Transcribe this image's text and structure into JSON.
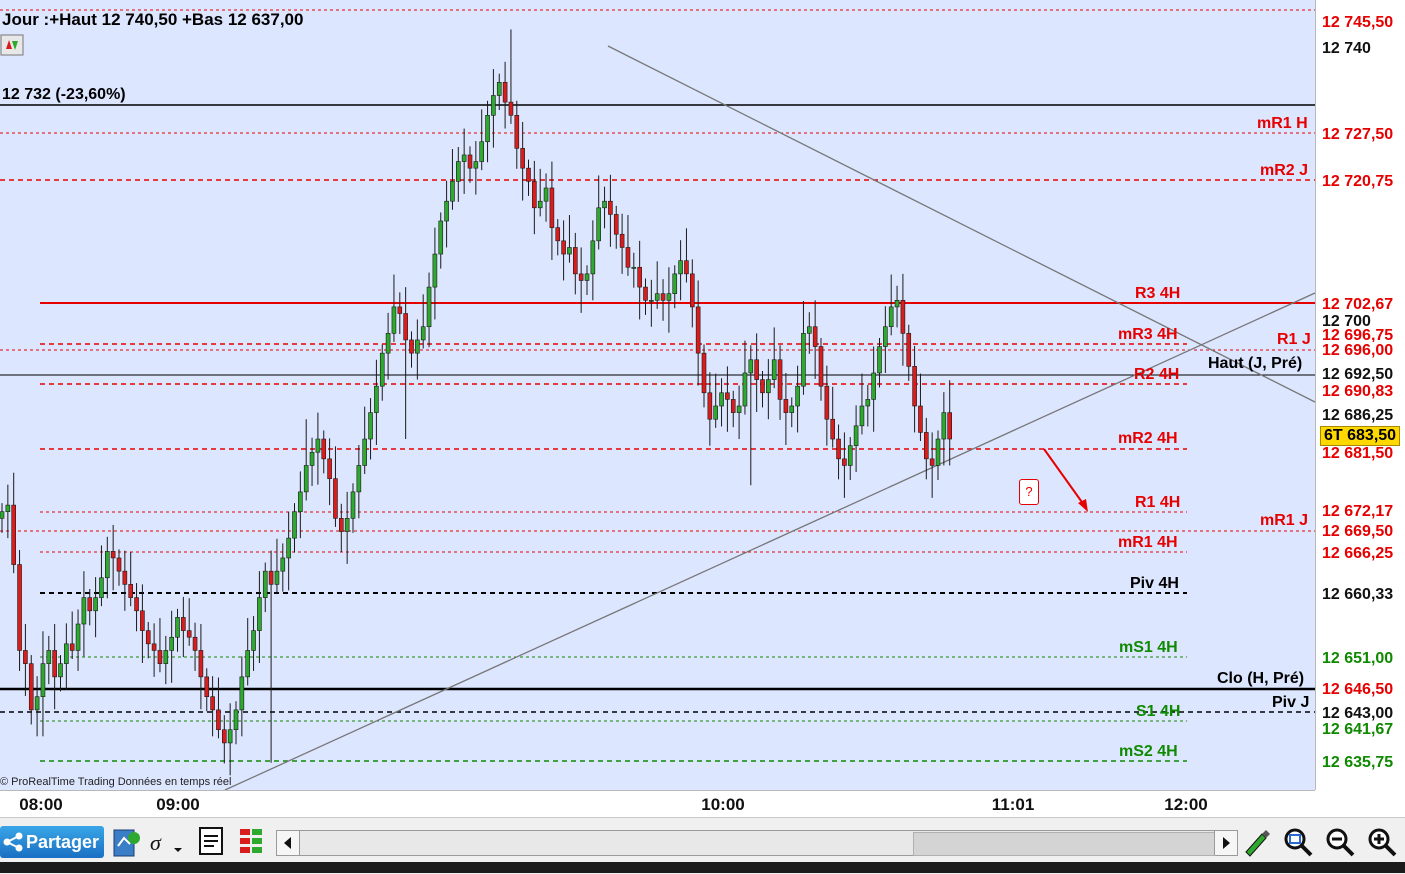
{
  "header": {
    "summary": "Jour :+Haut 12 740,50 +Bas 12 637,00",
    "fib_label": "12 732 (-23,60%)",
    "source_label": "© ProRealTime Trading  Données en temps réel",
    "question_marker": "?"
  },
  "price_axis": {
    "ticks": [
      "12 740",
      "12 700",
      "12 692,50",
      "12 686,25",
      "12 643,00"
    ],
    "red_tags": [
      "12 745,50",
      "12 727,50",
      "12 720,75",
      "12 702,67",
      "12 696,75",
      "12 696,00",
      "12 690,83",
      "12 681,50",
      "12 672,17",
      "12 669,50",
      "12 666,25",
      "12 646,50"
    ],
    "green_tags": [
      "12 651,00",
      "12 641,67",
      "12 635,75"
    ],
    "black_tags": [
      "12 660,33"
    ],
    "current_tag": "6T 683,50"
  },
  "time_axis": {
    "ticks": [
      "08:00",
      "09:00",
      "10:00",
      "11:01",
      "12:00"
    ]
  },
  "levels": {
    "mR1_H": "mR1 H",
    "mR2_J": "mR2 J",
    "R3_4H": "R3 4H",
    "mR3_4H": "mR3 4H",
    "R1_J": "R1 J",
    "haut_j_pre": "Haut (J, Pré)",
    "R2_4H": "R2 4H",
    "mR2_4H": "mR2 4H",
    "R1_4H": "R1 4H",
    "mR1_J": "mR1 J",
    "mR1_4H": "mR1 4H",
    "Piv_4H": "Piv 4H",
    "mS1_4H": "mS1 4H",
    "clo_h_pre": "Clo (H, Pré)",
    "Piv_J": "Piv J",
    "S1_4H": "S1 4H",
    "mS2_4H": "mS2 4H"
  },
  "toolbar": {
    "share_label": "Partager"
  },
  "colors": {
    "bull": "#2ea82e",
    "bear": "#d91c1c",
    "resistance": "#e60000",
    "support": "#0f8a00",
    "background": "#dde6ff"
  },
  "chart_data": {
    "type": "candlestick",
    "title": "Jour :+Haut 12 740,50 +Bas 12 637,00",
    "x_ticks": [
      "08:00",
      "09:00",
      "10:00",
      "11:01",
      "12:00"
    ],
    "ylim": [
      12632,
      12748
    ],
    "closes": [
      12673,
      12674,
      12665,
      12652,
      12650,
      12643,
      12645,
      12650,
      12652,
      12648,
      12650,
      12653,
      12652,
      12656,
      12660,
      12658,
      12660,
      12663,
      12667,
      12666,
      12664,
      12662,
      12660,
      12658,
      12655,
      12653,
      12652,
      12650,
      12652,
      12654,
      12657,
      12655,
      12654,
      12652,
      12648,
      12645,
      12643,
      12640,
      12638,
      12640,
      12643,
      12648,
      12652,
      12655,
      12660,
      12664,
      12662,
      12664,
      12666,
      12669,
      12673,
      12676,
      12680,
      12682,
      12684,
      12681,
      12678,
      12672,
      12670,
      12672,
      12676,
      12680,
      12684,
      12688,
      12692,
      12697,
      12700,
      12704,
      12703,
      12699,
      12697,
      12699,
      12701,
      12707,
      12712,
      12717,
      12720,
      12723,
      12726,
      12727,
      12725,
      12726,
      12729,
      12733,
      12736,
      12738,
      12735,
      12733,
      12728,
      12725,
      12723,
      12719,
      12720,
      12722,
      12716,
      12714,
      12712,
      12713,
      12709,
      12708,
      12709,
      12714,
      12719,
      12720,
      12718,
      12715,
      12713,
      12710,
      12710,
      12707,
      12705,
      12705,
      12706,
      12705,
      12706,
      12709,
      12711,
      12709,
      12704,
      12697,
      12691,
      12687,
      12689,
      12691,
      12690,
      12688,
      12689,
      12694,
      12696,
      12693,
      12691,
      12693,
      12696,
      12690,
      12688,
      12689,
      12692,
      12700,
      12701,
      12698,
      12692,
      12687,
      12684,
      12681,
      12680,
      12683,
      12686,
      12689,
      12690,
      12694,
      12698,
      12701,
      12704,
      12705,
      12700,
      12695,
      12689,
      12685,
      12681,
      12680,
      12684,
      12688,
      12684
    ],
    "open_first": 12672
  }
}
